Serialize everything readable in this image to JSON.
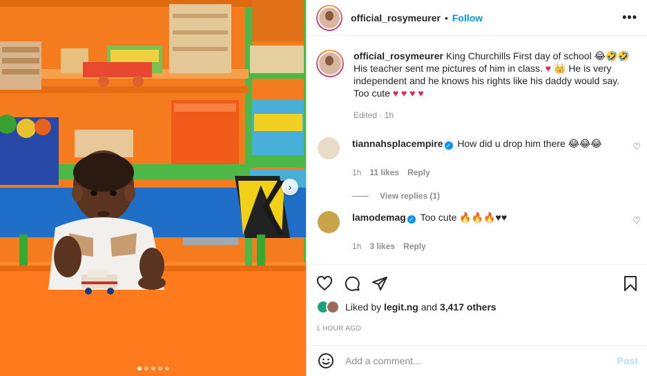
{
  "post": {
    "username": "official_rosymeurer",
    "follow_label": "Follow",
    "separator": "•",
    "more_icon": "more-options-icon"
  },
  "caption": {
    "username": "official_rosymeurer",
    "text_1": "King Churchills First day of school 😂🤣🤣",
    "text_2": "His teacher sent me pictures of him in class.",
    "emoji_heart": "♥",
    "emoji_crown": "👑",
    "text_3": "He is very independent and he knows his rights like his daddy would say. Too cute",
    "hearts": "♥ ♥ ♥ ♥",
    "edited": "Edited · 1h"
  },
  "comments": [
    {
      "username": "tiannahsplacempire",
      "verified": true,
      "text": "How did u drop him there 😂😂😂",
      "time": "1h",
      "likes": "11 likes",
      "reply": "Reply",
      "view_replies": "View replies (1)",
      "avatar_color": "#e8dcc8"
    },
    {
      "username": "lamodemag",
      "verified": true,
      "text": "Too cute 🔥🔥🔥♥♥",
      "time": "1h",
      "likes": "3 likes",
      "reply": "Reply",
      "avatar_color": "#c9a34a"
    }
  ],
  "actions": {
    "liked_by_prefix": "Liked by",
    "liked_by_user": "legit.ng",
    "and": "and",
    "others": "3,417 others",
    "timestamp": "1 HOUR AGO"
  },
  "add_comment": {
    "placeholder": "Add a comment...",
    "post_label": "Post"
  },
  "carousel": {
    "dots": 5,
    "active_index": 0,
    "next_icon": "chevron-right-icon"
  },
  "colors": {
    "accent": "#0095f6",
    "heart": "#e0245e",
    "muted": "#8e8e8e",
    "post_disabled": "#b2dffc"
  }
}
